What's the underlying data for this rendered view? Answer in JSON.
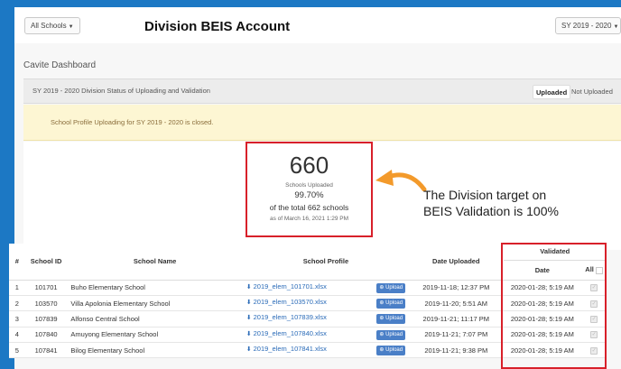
{
  "header": {
    "school_filter": "All Schools",
    "title": "Division BEIS Account",
    "sy_filter": "SY 2019 - 2020"
  },
  "dashboard_label": "Cavite Dashboard",
  "panel": {
    "title": "SY 2019 - 2020 Division Status of Uploading and Validation",
    "tabs": {
      "uploaded": "Uploaded",
      "not_uploaded": "Not Uploaded"
    }
  },
  "notice": "School Profile Uploading for SY 2019 - 2020 is closed.",
  "stats": {
    "count": "660",
    "count_label": "Schools Uploaded",
    "percent": "99.70%",
    "of_total": "of the total 662 schools",
    "as_of": "as of March 16, 2021 1:29 PM"
  },
  "annotation": {
    "line1": "The Division target on",
    "line2": "BEIS Validation is 100%"
  },
  "table": {
    "headers": {
      "num": "#",
      "school_id": "School ID",
      "school_name": "School Name",
      "school_profile": "School Profile",
      "date_uploaded": "Date Uploaded",
      "validated": "Validated",
      "date": "Date",
      "all": "All"
    },
    "upload_label": "Upload",
    "rows": [
      {
        "num": "1",
        "id": "101701",
        "name": "Buho Elementary School",
        "file": "2019_elem_101701.xlsx",
        "uploaded": "2019-11-18; 12:37 PM",
        "validated": "2020-01-28; 5:19 AM"
      },
      {
        "num": "2",
        "id": "103570",
        "name": "Villa Apolonia Elementary School",
        "file": "2019_elem_103570.xlsx",
        "uploaded": "2019-11-20; 5:51 AM",
        "validated": "2020-01-28; 5:19 AM"
      },
      {
        "num": "3",
        "id": "107839",
        "name": "Alfonso Central School",
        "file": "2019_elem_107839.xlsx",
        "uploaded": "2019-11-21; 11:17 PM",
        "validated": "2020-01-28; 5:19 AM"
      },
      {
        "num": "4",
        "id": "107840",
        "name": "Amuyong Elementary School",
        "file": "2019_elem_107840.xlsx",
        "uploaded": "2019-11-21; 7:07 PM",
        "validated": "2020-01-28; 5:19 AM"
      },
      {
        "num": "5",
        "id": "107841",
        "name": "Bilog Elementary School",
        "file": "2019_elem_107841.xlsx",
        "uploaded": "2019-11-21; 9:38 PM",
        "validated": "2020-01-28; 5:19 AM"
      }
    ]
  },
  "colors": {
    "accent_blue": "#1c78c4",
    "highlight_red": "#d8202a",
    "arrow_orange": "#f39a2b",
    "notice_bg": "#fdf6d3",
    "link": "#2a6bb8",
    "upload_button": "#4a7fc7"
  }
}
